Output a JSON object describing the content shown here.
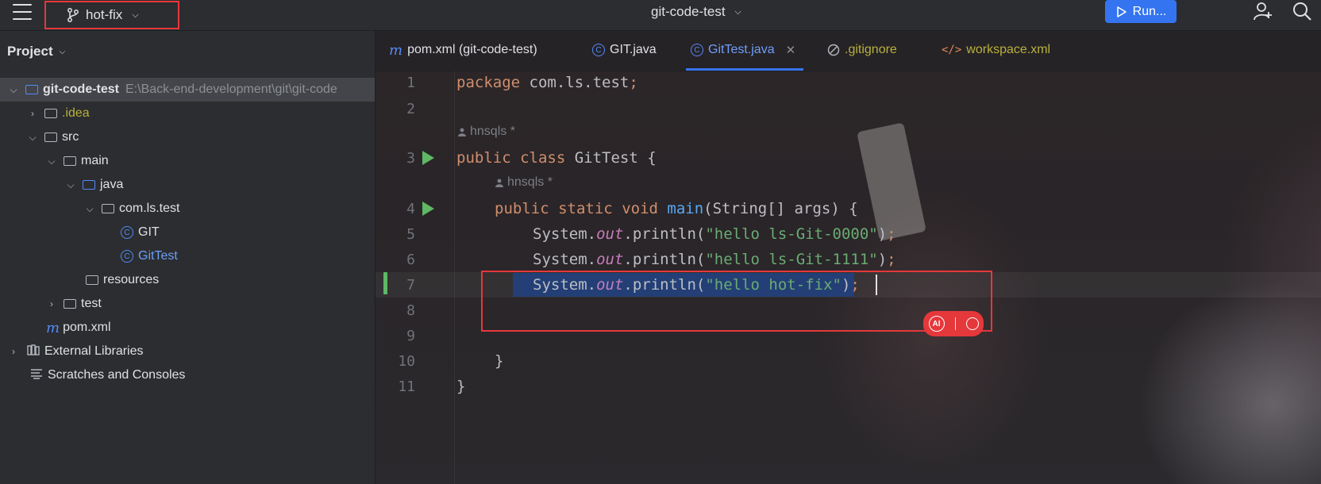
{
  "titlebar": {
    "branch": "hot-fix",
    "project": "git-code-test",
    "run_label": "Run..."
  },
  "project_pane": {
    "title": "Project",
    "tree": {
      "root_name": "git-code-test",
      "root_path": "E:\\Back-end-development\\git\\git-code",
      "idea": ".idea",
      "src": "src",
      "main": "main",
      "java": "java",
      "package": "com.ls.test",
      "class_git": "GIT",
      "class_gittest": "GitTest",
      "resources": "resources",
      "test": "test",
      "pom": "pom.xml",
      "external_libraries": "External Libraries",
      "scratches": "Scratches and Consoles"
    }
  },
  "tabs": [
    {
      "label": "pom.xml (git-code-test)",
      "icon": "m"
    },
    {
      "label": "GIT.java",
      "icon": "c"
    },
    {
      "label": "GitTest.java",
      "icon": "c"
    },
    {
      "label": ".gitignore",
      "icon": "ignore"
    },
    {
      "label": "workspace.xml",
      "icon": "</>"
    }
  ],
  "editor": {
    "line_numbers": [
      "1",
      "2",
      "3",
      "4",
      "5",
      "6",
      "7",
      "8",
      "9",
      "10",
      "11"
    ],
    "author_hint": "hnsqls *",
    "code": {
      "package_kw": "package",
      "package_name": " com.ls.test",
      "semicolon": ";",
      "public": "public",
      "class": "class",
      "class_name": " GitTest {",
      "static": "static",
      "void": "void",
      "main": "main",
      "main_params": "(String[] args) {",
      "system": "System.",
      "out": "out",
      "println": ".println(",
      "str1": "\"hello ls-Git-0000\"",
      "str2": "\"hello ls-Git-1111\"",
      "str3": "\"hello hot-fix\"",
      "close_paren": ")",
      "brace_inner": "}",
      "brace_outer": "}"
    }
  }
}
